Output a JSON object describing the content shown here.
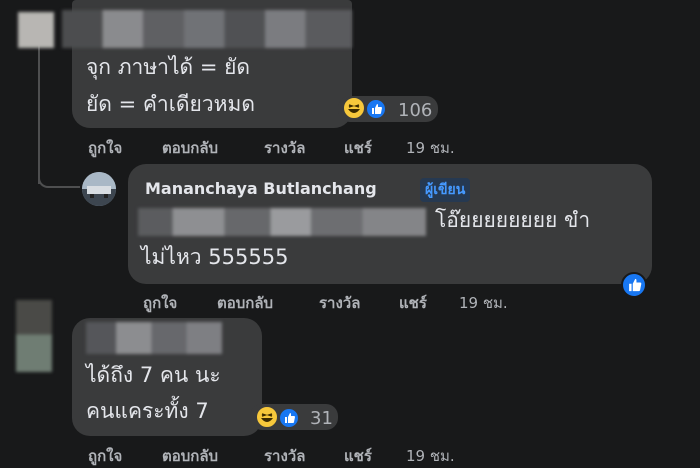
{
  "comments": [
    {
      "text_lines": [
        "จุก ภาษาได้ = ยัด",
        "ยัด = คำเดียวหมด"
      ],
      "reaction_count": "106",
      "actions": {
        "like": "ถูกใจ",
        "reply": "ตอบกลับ",
        "award": "รางวัล",
        "share": "แชร์",
        "time": "19 ชม."
      }
    },
    {
      "author": "Mananchaya Butlanchang",
      "badge": "ผู้เขียน",
      "text_lines": [
        "โอ๊ยยยยยยยย ขำ",
        "ไม่ไหว 555555"
      ],
      "actions": {
        "like": "ถูกใจ",
        "reply": "ตอบกลับ",
        "award": "รางวัล",
        "share": "แชร์",
        "time": "19 ชม."
      }
    },
    {
      "text_lines": [
        "ได้ถึง 7 คน นะ",
        "คนแคระทั้ง 7"
      ],
      "reaction_count": "31",
      "actions": {
        "like": "ถูกใจ",
        "reply": "ตอบกลับ",
        "award": "รางวัล",
        "share": "แชร์",
        "time": "19 ชม."
      }
    }
  ],
  "icons": {
    "like": "like-reaction-icon",
    "haha": "haha-reaction-icon"
  },
  "colors": {
    "background": "#18191a",
    "bubble": "#3a3b3c",
    "text": "#e4e6eb",
    "muted": "#b0b3b8",
    "like_blue": "#1877f2",
    "haha_yellow": "#f7c83b",
    "badge_bg": "#263951",
    "badge_text": "#4599ff"
  }
}
